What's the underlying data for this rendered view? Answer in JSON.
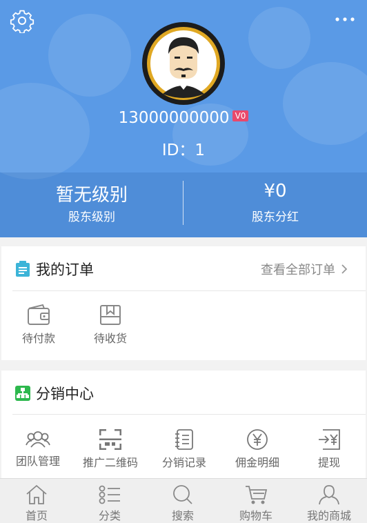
{
  "profile": {
    "phone": "13000000000",
    "level_badge": "V0",
    "id_text": "ID：1"
  },
  "stats": [
    {
      "value": "暂无级别",
      "label": "股东级别"
    },
    {
      "value": "¥0",
      "label": "股东分红"
    }
  ],
  "orders": {
    "title": "我的订单",
    "view_all": "查看全部订单",
    "items": [
      {
        "label": "待付款",
        "icon": "wallet-icon"
      },
      {
        "label": "待收货",
        "icon": "package-icon"
      }
    ]
  },
  "distribution": {
    "title": "分销中心",
    "items": [
      {
        "label": "团队管理",
        "icon": "team-icon"
      },
      {
        "label": "推广二维码",
        "icon": "qr-code-icon"
      },
      {
        "label": "分销记录",
        "icon": "notebook-icon"
      },
      {
        "label": "佣金明细",
        "icon": "yen-circle-icon"
      },
      {
        "label": "提现",
        "icon": "withdraw-icon"
      }
    ]
  },
  "tabbar": [
    {
      "label": "首页",
      "icon": "home-icon"
    },
    {
      "label": "分类",
      "icon": "category-list-icon"
    },
    {
      "label": "搜索",
      "icon": "search-icon"
    },
    {
      "label": "购物车",
      "icon": "cart-icon"
    },
    {
      "label": "我的商城",
      "icon": "user-icon"
    }
  ],
  "colors": {
    "header_bg": "#5a9ae6",
    "badge": "#e9496b",
    "order_icon": "#3cb4d8",
    "distribution_icon": "#2db84d",
    "avatar_ring": "#e0a823"
  }
}
